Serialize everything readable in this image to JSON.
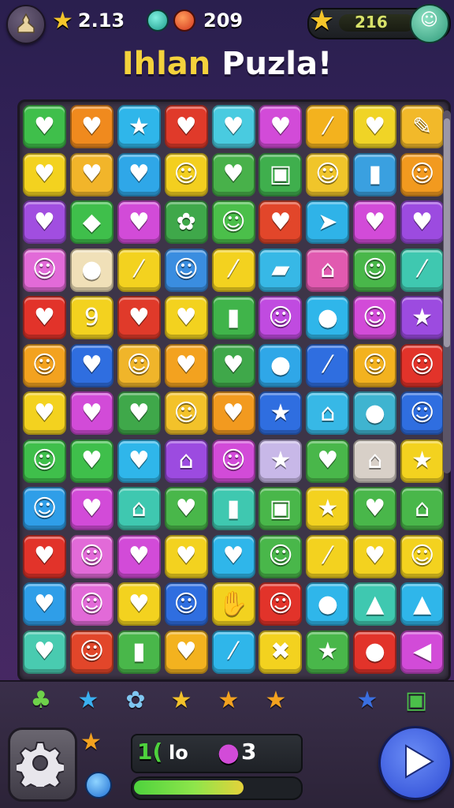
{
  "topbar": {
    "stars": "2.13",
    "coins": "209",
    "energy": "216"
  },
  "title": {
    "part1": "Ihlan",
    "part2": "Puzla!"
  },
  "board": {
    "tiles": [
      [
        {
          "c": "#3fbf4b",
          "g": "♥",
          "i": "heart-icon"
        },
        {
          "c": "#f08a1e",
          "g": "♥",
          "i": "heart-icon"
        },
        {
          "c": "#2fb6ea",
          "g": "★",
          "i": "star-icon"
        },
        {
          "c": "#e03a2a",
          "g": "♥",
          "i": "heart-icon"
        },
        {
          "c": "#49cbe0",
          "g": "♥",
          "i": "heart-icon"
        },
        {
          "c": "#d24bd8",
          "g": "♥",
          "i": "heart-icon"
        },
        {
          "c": "#f3b21e",
          "g": "⁄",
          "i": "stick-icon"
        },
        {
          "c": "#f0d426",
          "g": "♥",
          "i": "heart-icon"
        },
        {
          "c": "#f2b92a",
          "g": "✎",
          "i": "pencil-icon"
        }
      ],
      [
        {
          "c": "#f3d21f",
          "g": "♥",
          "i": "heart-icon"
        },
        {
          "c": "#f2b52a",
          "g": "♥",
          "i": "heart-icon"
        },
        {
          "c": "#2fa7e8",
          "g": "♥",
          "i": "heart-icon"
        },
        {
          "c": "#f3cf1f",
          "g": "☺",
          "i": "face-icon"
        },
        {
          "c": "#48b14a",
          "g": "♥",
          "i": "heart-icon"
        },
        {
          "c": "#3faf4d",
          "g": "▣",
          "i": "box-icon"
        },
        {
          "c": "#f0c52a",
          "g": "☺",
          "i": "person-icon"
        },
        {
          "c": "#3aa0e0",
          "g": "▮",
          "i": "jar-icon"
        },
        {
          "c": "#f29a1f",
          "g": "☺",
          "i": "robot-icon"
        }
      ],
      [
        {
          "c": "#a14ee0",
          "g": "♥",
          "i": "heart-icon"
        },
        {
          "c": "#3fbf4b",
          "g": "◆",
          "i": "bag-icon"
        },
        {
          "c": "#d24bd8",
          "g": "♥",
          "i": "heart-icon"
        },
        {
          "c": "#3fa84a",
          "g": "✿",
          "i": "frog-icon"
        },
        {
          "c": "#4bbf4a",
          "g": "☺",
          "i": "bear-icon"
        },
        {
          "c": "#e2462a",
          "g": "♥",
          "i": "heart-icon"
        },
        {
          "c": "#2fb3e8",
          "g": "➤",
          "i": "arrow-icon"
        },
        {
          "c": "#d24bd8",
          "g": "♥",
          "i": "heart-icon"
        },
        {
          "c": "#9c4be0",
          "g": "♥",
          "i": "heart-icon"
        }
      ],
      [
        {
          "c": "#e26ad8",
          "g": "☺",
          "i": "face-icon"
        },
        {
          "c": "#f0e0b8",
          "g": "●",
          "i": "pot-icon"
        },
        {
          "c": "#f3d21f",
          "g": "⁄",
          "i": "stick-icon"
        },
        {
          "c": "#3a8de0",
          "g": "☺",
          "i": "face-icon"
        },
        {
          "c": "#f3d21f",
          "g": "⁄",
          "i": "banana-icon"
        },
        {
          "c": "#37b8e6",
          "g": "▰",
          "i": "flag-icon"
        },
        {
          "c": "#e15ab0",
          "g": "⌂",
          "i": "house-icon"
        },
        {
          "c": "#49b74a",
          "g": "☺",
          "i": "robot-icon"
        },
        {
          "c": "#3fc8b0",
          "g": "⁄",
          "i": "bone-icon"
        }
      ],
      [
        {
          "c": "#e2332a",
          "g": "♥",
          "i": "heart-icon"
        },
        {
          "c": "#f3d21f",
          "g": "9",
          "i": "digit-icon"
        },
        {
          "c": "#e03a2a",
          "g": "♥",
          "i": "heart-icon"
        },
        {
          "c": "#f3d21f",
          "g": "♥",
          "i": "heart-icon"
        },
        {
          "c": "#40b44a",
          "g": "▮",
          "i": "cup-icon"
        },
        {
          "c": "#c04be0",
          "g": "☺",
          "i": "flower-icon"
        },
        {
          "c": "#2fb6ea",
          "g": "●",
          "i": "lemon-icon"
        },
        {
          "c": "#d24bd8",
          "g": "☺",
          "i": "face-icon"
        },
        {
          "c": "#9c4be0",
          "g": "★",
          "i": "star-icon"
        }
      ],
      [
        {
          "c": "#f3a21f",
          "g": "☺",
          "i": "face-icon"
        },
        {
          "c": "#2f6ee0",
          "g": "♥",
          "i": "heart-icon"
        },
        {
          "c": "#f0b52a",
          "g": "☺",
          "i": "bear-icon"
        },
        {
          "c": "#f3a21f",
          "g": "♥",
          "i": "heart-icon"
        },
        {
          "c": "#3fa84a",
          "g": "♥",
          "i": "heart-icon"
        },
        {
          "c": "#2fa7e8",
          "g": "●",
          "i": "egg-icon"
        },
        {
          "c": "#2f6ee0",
          "g": "⁄",
          "i": "ticket-icon"
        },
        {
          "c": "#f3b21f",
          "g": "☺",
          "i": "bear-icon"
        },
        {
          "c": "#e2332a",
          "g": "☺",
          "i": "creature-icon"
        }
      ],
      [
        {
          "c": "#f3d21f",
          "g": "♥",
          "i": "heart-icon"
        },
        {
          "c": "#d24bd8",
          "g": "♥",
          "i": "heart-icon"
        },
        {
          "c": "#3fa84a",
          "g": "♥",
          "i": "heart-icon"
        },
        {
          "c": "#f3c22a",
          "g": "☺",
          "i": "bear-icon"
        },
        {
          "c": "#f29a1f",
          "g": "♥",
          "i": "heart-icon"
        },
        {
          "c": "#2f6ee0",
          "g": "★",
          "i": "star-icon"
        },
        {
          "c": "#37b8e6",
          "g": "⌂",
          "i": "trash-icon"
        },
        {
          "c": "#3fb4d0",
          "g": "●",
          "i": "apple-icon"
        },
        {
          "c": "#2f6ee0",
          "g": "☺",
          "i": "lion-icon"
        }
      ],
      [
        {
          "c": "#3fbf4b",
          "g": "☺",
          "i": "face-icon"
        },
        {
          "c": "#3fbf4b",
          "g": "♥",
          "i": "heart-icon"
        },
        {
          "c": "#2fb6ea",
          "g": "♥",
          "i": "heart-icon"
        },
        {
          "c": "#9c4be0",
          "g": "⌂",
          "i": "house-icon"
        },
        {
          "c": "#d24bd8",
          "g": "☺",
          "i": "face-icon"
        },
        {
          "c": "#c8b8e8",
          "g": "★",
          "i": "star-icon"
        },
        {
          "c": "#49b74a",
          "g": "♥",
          "i": "heart-icon"
        },
        {
          "c": "#d8d0c8",
          "g": "⌂",
          "i": "building-icon"
        },
        {
          "c": "#f3d21f",
          "g": "★",
          "i": "star-icon"
        }
      ],
      [
        {
          "c": "#2f9ee8",
          "g": "☺",
          "i": "face-icon"
        },
        {
          "c": "#d24bd8",
          "g": "♥",
          "i": "heart-icon"
        },
        {
          "c": "#3fc8b0",
          "g": "⌂",
          "i": "hat-icon"
        },
        {
          "c": "#49b74a",
          "g": "♥",
          "i": "heart-icon"
        },
        {
          "c": "#3fc8b0",
          "g": "▮",
          "i": "trash-icon"
        },
        {
          "c": "#49b74a",
          "g": "▣",
          "i": "picture-icon"
        },
        {
          "c": "#f3d21f",
          "g": "★",
          "i": "star-icon"
        },
        {
          "c": "#49b74a",
          "g": "♥",
          "i": "heart-icon"
        },
        {
          "c": "#49b74a",
          "g": "⌂",
          "i": "house-icon"
        }
      ],
      [
        {
          "c": "#e2332a",
          "g": "♥",
          "i": "heart-icon"
        },
        {
          "c": "#e26ad8",
          "g": "☺",
          "i": "pig-icon"
        },
        {
          "c": "#d24bd8",
          "g": "♥",
          "i": "heart-icon"
        },
        {
          "c": "#f3d21f",
          "g": "♥",
          "i": "heart-icon"
        },
        {
          "c": "#2fb6ea",
          "g": "♥",
          "i": "heart-icon"
        },
        {
          "c": "#49b74a",
          "g": "☺",
          "i": "face-icon"
        },
        {
          "c": "#f3d21f",
          "g": "⁄",
          "i": "stick-icon"
        },
        {
          "c": "#f3d21f",
          "g": "♥",
          "i": "heart-icon"
        },
        {
          "c": "#f3d21f",
          "g": "☺",
          "i": "face-icon"
        }
      ],
      [
        {
          "c": "#2f9ee8",
          "g": "♥",
          "i": "heart-icon"
        },
        {
          "c": "#e26ad8",
          "g": "☺",
          "i": "face-icon"
        },
        {
          "c": "#f3d21f",
          "g": "♥",
          "i": "heart-icon"
        },
        {
          "c": "#2f6ee0",
          "g": "☺",
          "i": "chick-icon"
        },
        {
          "c": "#f3d21f",
          "g": "✋",
          "i": "sock-icon"
        },
        {
          "c": "#e2332a",
          "g": "☺",
          "i": "bear-icon"
        },
        {
          "c": "#2fb6ea",
          "g": "●",
          "i": "apple-icon"
        },
        {
          "c": "#3fc8b0",
          "g": "▲",
          "i": "top-icon"
        },
        {
          "c": "#2fb6ea",
          "g": "▲",
          "i": "drop-icon"
        }
      ],
      [
        {
          "c": "#49cbb0",
          "g": "♥",
          "i": "heart-icon"
        },
        {
          "c": "#e2462a",
          "g": "☺",
          "i": "monkey-icon"
        },
        {
          "c": "#49b74a",
          "g": "▮",
          "i": "pot-icon"
        },
        {
          "c": "#f3b21f",
          "g": "♥",
          "i": "heart-icon"
        },
        {
          "c": "#2fb6ea",
          "g": "⁄",
          "i": "bottle-icon"
        },
        {
          "c": "#f3d21f",
          "g": "✖",
          "i": "bow-icon"
        },
        {
          "c": "#49b74a",
          "g": "★",
          "i": "star-icon"
        },
        {
          "c": "#e2332a",
          "g": "●",
          "i": "swirl-icon"
        },
        {
          "c": "#d24bd8",
          "g": "◀",
          "i": "speaker-icon"
        }
      ]
    ]
  },
  "tray": {
    "items": [
      {
        "g": "♣",
        "i": "fruit-icon",
        "c": "#6ed24a"
      },
      {
        "g": "★",
        "i": "star-icon",
        "c": "#3ab0f0"
      },
      {
        "g": "✿",
        "i": "shirt-icon",
        "c": "#7fc6f0"
      },
      {
        "g": "★",
        "i": "star-icon",
        "c": "#f3c22a"
      },
      {
        "g": "★",
        "i": "fruit-star-icon",
        "c": "#f3a21f"
      },
      {
        "g": "★",
        "i": "star-icon",
        "c": "#f3a21f"
      },
      {
        "g": "★",
        "i": "star-icon",
        "c": "#3a6fe0"
      },
      {
        "g": "▣",
        "i": "gift-icon",
        "c": "#4bbf4a"
      }
    ],
    "combo": "1(",
    "combo_text": "lo",
    "drops": "3",
    "progress": 0.66
  }
}
